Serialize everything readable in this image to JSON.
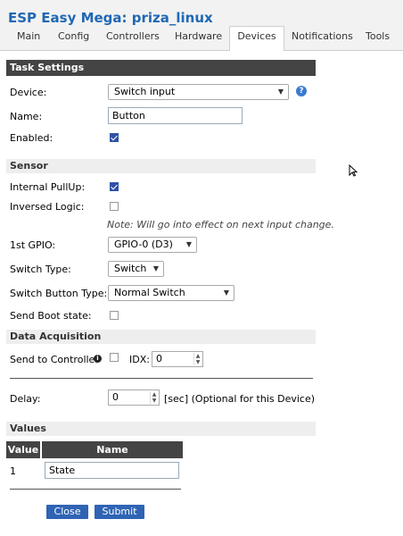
{
  "header": {
    "title": "ESP Easy Mega: priza_linux"
  },
  "tabs": [
    "Main",
    "Config",
    "Controllers",
    "Hardware",
    "Devices",
    "Notifications",
    "Tools"
  ],
  "sections": {
    "task_settings": "Task Settings",
    "sensor": "Sensor",
    "data_acquisition": "Data Acquisition",
    "values": "Values"
  },
  "fields": {
    "device_label": "Device:",
    "device_value": "Switch input",
    "name_label": "Name:",
    "name_value": "Button",
    "enabled_label": "Enabled:",
    "internal_pullup_label": "Internal PullUp:",
    "inversed_logic_label": "Inversed Logic:",
    "note": "Note: Will go into effect on next input change.",
    "gpio_label": "1st GPIO:",
    "gpio_value": "GPIO-0 (D3)",
    "switch_type_label": "Switch Type:",
    "switch_type_value": "Switch",
    "switch_button_type_label": "Switch Button Type:",
    "switch_button_type_value": "Normal Switch",
    "send_boot_label": "Send Boot state:",
    "send_to_controller_label": "Send to Controller",
    "idx_label": "IDX:",
    "idx_value": "0",
    "delay_label": "Delay:",
    "delay_value": "0",
    "delay_suffix": "[sec] (Optional for this Device)"
  },
  "checkboxes": {
    "enabled": true,
    "internal_pullup": true,
    "inversed_logic": false,
    "send_boot_state": false,
    "send_to_controller": false
  },
  "values_table": {
    "headers": [
      "Value",
      "Name"
    ],
    "rows": [
      {
        "value": "1",
        "name": "State"
      }
    ]
  },
  "buttons": {
    "close": "Close",
    "submit": "Submit"
  },
  "help_icon": "?",
  "info_icon": "i",
  "colors": {
    "accent": "#1f68b5",
    "button": "#2f64b4",
    "section_dark": "#444444"
  }
}
